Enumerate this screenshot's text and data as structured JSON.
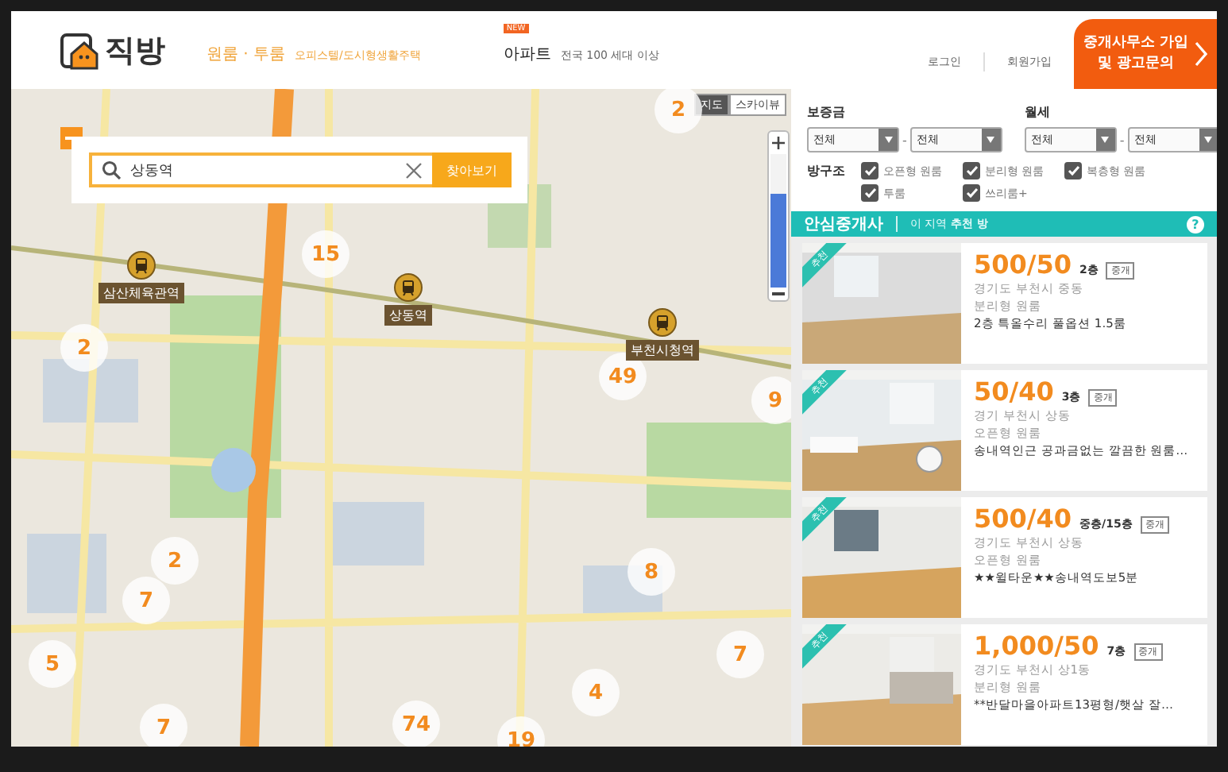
{
  "header": {
    "logo": "직방",
    "nav": [
      {
        "label": "원룸 · 투룸",
        "sub": "오피스텔/도시형생활주택",
        "selected": true
      },
      {
        "label": "아파트",
        "sub": "전국 100 세대 이상",
        "badge": "NEW",
        "selected": false
      }
    ],
    "account_links": [
      "로그인",
      "회원가입"
    ],
    "cta_button": [
      "중개사무소 가입",
      "및 광고문의"
    ]
  },
  "map": {
    "search": {
      "value": "상동역",
      "button": "찾아보기"
    },
    "zoom": {
      "level": 0.7
    },
    "map_types": [
      {
        "label": "지도",
        "selected": true
      },
      {
        "label": "스카이뷰",
        "selected": false
      }
    ],
    "clusters": [
      {
        "count": "2"
      },
      {
        "count": "15"
      },
      {
        "count": "2"
      },
      {
        "count": "49"
      },
      {
        "count": "9"
      },
      {
        "count": "2"
      },
      {
        "count": "7"
      },
      {
        "count": "8"
      },
      {
        "count": "5"
      },
      {
        "count": "7"
      },
      {
        "count": "4"
      },
      {
        "count": "7"
      },
      {
        "count": "74"
      },
      {
        "count": "19"
      }
    ],
    "stations": [
      {
        "name": "삼산체육관역"
      },
      {
        "name": "상동역"
      },
      {
        "name": "부천시청역"
      }
    ]
  },
  "filters": {
    "price": [
      {
        "label": "보증금",
        "from": "전체",
        "separator": "-",
        "to": "전체"
      },
      {
        "label": "월세",
        "from": "전체",
        "separator": "-",
        "to": "전체"
      }
    ],
    "room_types": {
      "label": "방구조",
      "options": [
        {
          "label": "오픈형 원룸",
          "checked": true
        },
        {
          "label": "분리형 원룸",
          "checked": true
        },
        {
          "label": "복층형 원룸",
          "checked": true
        },
        {
          "label": "투룸",
          "checked": true
        },
        {
          "label": "쓰리룸+",
          "checked": true
        }
      ]
    }
  },
  "recommend_bar": {
    "title": "안심중개사",
    "subtitle": "이 지역 **추천 방**",
    "help": "?"
  },
  "listings": [
    {
      "badge": "추천",
      "price": "500/50",
      "floor": "2층",
      "tag": "중개",
      "address": "경기도 부천시 중동",
      "type": "분리형 원룸",
      "description": "2층 특올수리 풀옵션 1.5룸"
    },
    {
      "badge": "추천",
      "price": "50/40",
      "floor": "3층",
      "tag": "중개",
      "address": "경기 부천시 상동",
      "type": "오픈형 원룸",
      "description": "송내역인근 공과금없는 깔끔한 원룸…"
    },
    {
      "badge": "추천",
      "price": "500/40",
      "floor": "중층/15층",
      "tag": "중개",
      "address": "경기도 부천시 상동",
      "type": "오픈형 원룸",
      "description": "★★윌타운★★송내역도보5분"
    },
    {
      "badge": "추천",
      "price": "1,000/50",
      "floor": "7층",
      "tag": "중개",
      "address": "경기도 부천시 상1동",
      "type": "분리형 원룸",
      "description": "**반달마을아파트13평형/햇살 잘…"
    }
  ]
}
